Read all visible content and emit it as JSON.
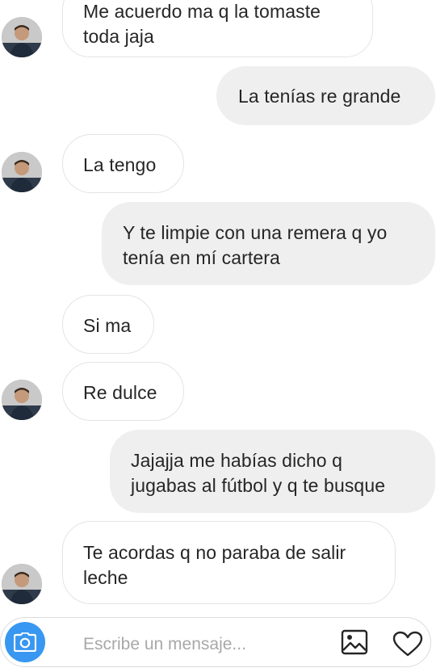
{
  "messages": [
    {
      "side": "in",
      "lines": [
        "Me acuerdo ma q la tomaste",
        "toda jaja"
      ],
      "avatar": true
    },
    {
      "side": "out",
      "lines": [
        "La tenías re grande"
      ]
    },
    {
      "side": "in",
      "lines": [
        "La tengo"
      ],
      "avatar": true
    },
    {
      "side": "out",
      "lines": [
        "Y te limpie con una remera q yo",
        "tenía en mí cartera"
      ]
    },
    {
      "side": "in",
      "lines": [
        "Si ma"
      ],
      "avatar": false
    },
    {
      "side": "in",
      "lines": [
        "Re dulce"
      ],
      "avatar": true
    },
    {
      "side": "out",
      "lines": [
        "Jajajja me habías dicho q",
        "jugabas al fútbol y q te busque"
      ]
    },
    {
      "side": "in",
      "lines": [
        "Te acordas q no paraba de salir",
        "leche"
      ],
      "avatar": true
    }
  ],
  "composer": {
    "placeholder": "Escribe un mensaje...",
    "camera_icon": "camera-icon",
    "gallery_icon": "image-icon",
    "like_icon": "heart-icon",
    "accent": "#3897f0"
  }
}
